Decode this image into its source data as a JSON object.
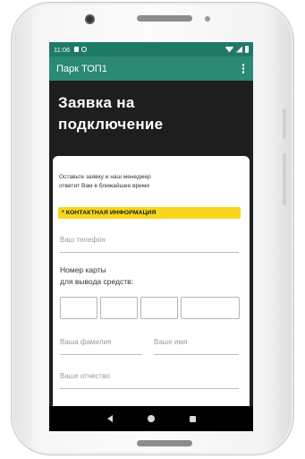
{
  "status_bar": {
    "time": "11:06"
  },
  "app_bar": {
    "title": "Парк ТОП1"
  },
  "page": {
    "title_line1": "Заявка на",
    "title_line2": "подключение"
  },
  "form": {
    "intro_line1": "Оставьте заявку и наш менеджер",
    "intro_line2": "ответит Вам в ближайшее время",
    "section_label": "* КОНТАКТНАЯ ИНФОРМАЦИЯ",
    "phone_placeholder": "Ваш телефон",
    "card_label_line1": "Номер карты",
    "card_label_line2": "для вывода средств:",
    "card_digits": [
      "",
      "",
      "",
      ""
    ],
    "lastname_placeholder": "Ваша фамилия",
    "firstname_placeholder": "Ваше имя",
    "patronymic_placeholder": "Ваше отчество"
  },
  "icons": {
    "menu": "more-vert-icon",
    "back": "nav-back-icon",
    "home": "nav-home-icon",
    "recent": "nav-recent-icon"
  },
  "colors": {
    "status_bar": "#1f7a65",
    "app_bar": "#2a8a72",
    "badge": "#f7d51d",
    "screen_bg": "#1e1e1e"
  }
}
